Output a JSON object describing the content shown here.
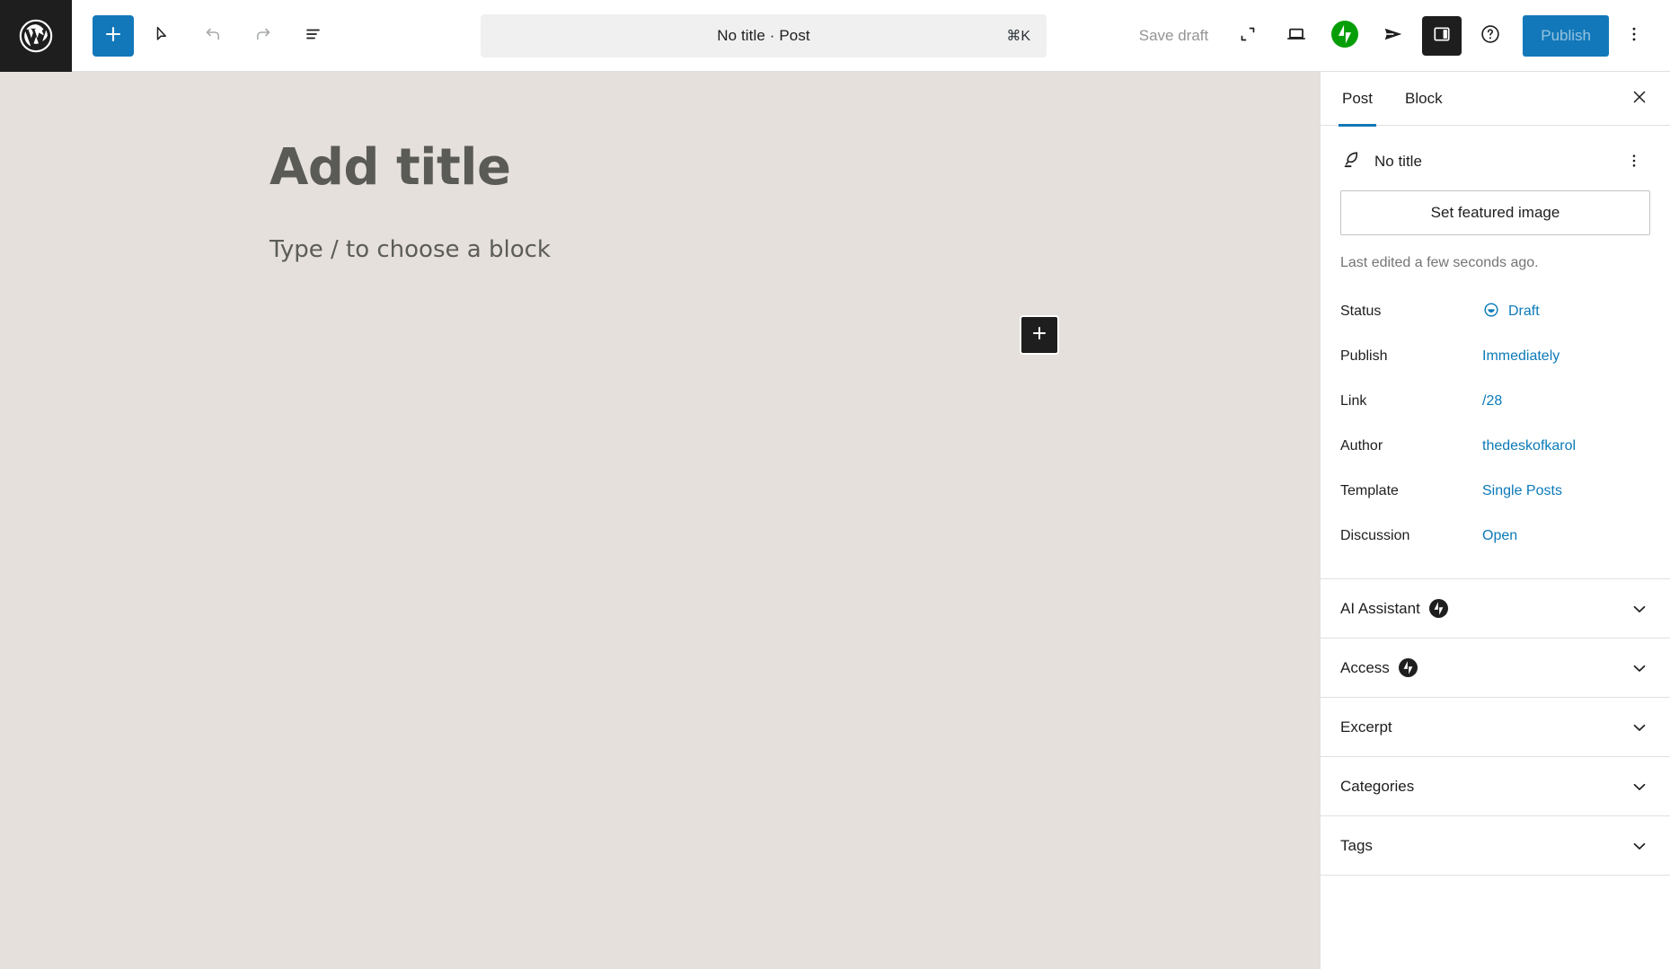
{
  "toolbar": {
    "logo_icon": "wordpress-logo-icon",
    "add_block_label": "+",
    "add_block_icon": "plus-icon",
    "tools_icon": "cursor-tools-icon",
    "undo_icon": "undo-icon",
    "redo_icon": "redo-icon",
    "list_view_icon": "document-overview-icon",
    "command_title": "No title · Post",
    "command_shortcut": "⌘K",
    "save_draft_label": "Save draft",
    "preview_icon": "expand-preview-icon",
    "device_icon": "desktop-view-icon",
    "jetpack_icon": "jetpack-icon",
    "publish_send_icon": "send-icon",
    "sidebar_toggle_icon": "settings-sidebar-icon",
    "help_icon": "help-icon",
    "publish_label": "Publish",
    "more_icon": "more-options-icon",
    "accent_blue": "#1278b9",
    "jetpack_green": "#069e08"
  },
  "canvas": {
    "title_placeholder": "Add title",
    "block_placeholder": "Type / to choose a block",
    "inserter_icon": "plus-icon",
    "background_color": "#e5e0db"
  },
  "sidebar": {
    "tabs": [
      {
        "label": "Post",
        "active": true
      },
      {
        "label": "Block",
        "active": false
      }
    ],
    "close_icon": "close-icon",
    "document": {
      "type_icon": "post-quill-icon",
      "title": "No title",
      "more_icon": "more-options-icon"
    },
    "featured_image_label": "Set featured image",
    "last_edited": "Last edited a few seconds ago.",
    "meta": [
      {
        "label": "Status",
        "value": "Draft",
        "icon": "draft-status-icon"
      },
      {
        "label": "Publish",
        "value": "Immediately",
        "icon": ""
      },
      {
        "label": "Link",
        "value": "/28",
        "icon": ""
      },
      {
        "label": "Author",
        "value": "thedeskofkarol",
        "icon": ""
      },
      {
        "label": "Template",
        "value": "Single Posts",
        "icon": ""
      },
      {
        "label": "Discussion",
        "value": "Open",
        "icon": ""
      }
    ],
    "panels": [
      {
        "label": "AI Assistant",
        "badge": "jetpack-badge-icon",
        "chevron": "chevron-down-icon"
      },
      {
        "label": "Access",
        "badge": "jetpack-badge-icon",
        "chevron": "chevron-down-icon"
      },
      {
        "label": "Excerpt",
        "badge": "",
        "chevron": "chevron-down-icon"
      },
      {
        "label": "Categories",
        "badge": "",
        "chevron": "chevron-down-icon"
      },
      {
        "label": "Tags",
        "badge": "",
        "chevron": "chevron-down-icon"
      }
    ],
    "link_color": "#0b7ab8"
  }
}
